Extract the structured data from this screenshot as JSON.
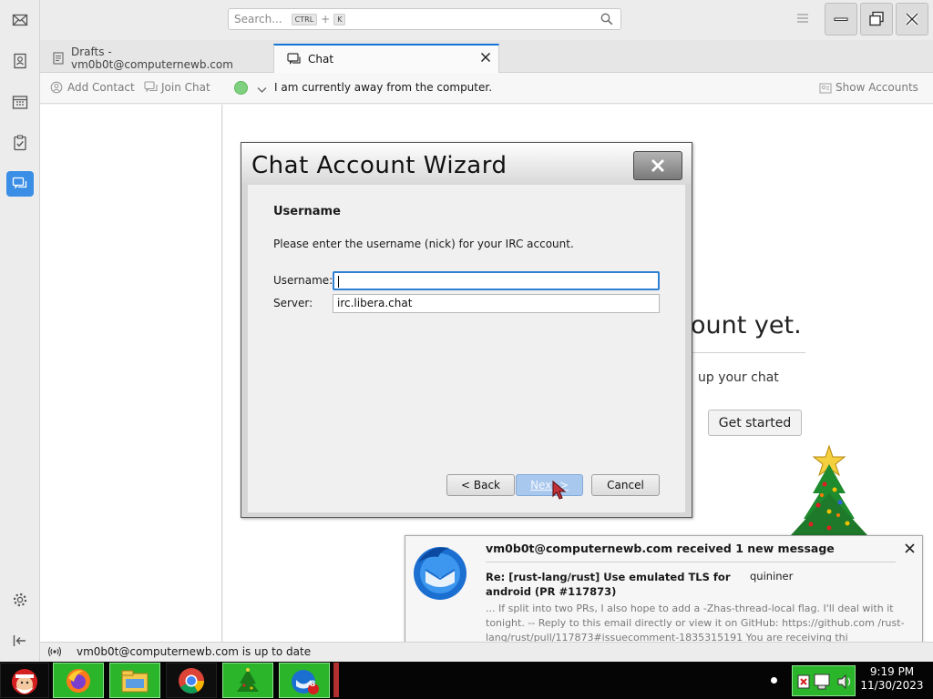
{
  "titlebar": {
    "search_placeholder": "Search...",
    "shortcut_mod": "CTRL",
    "shortcut_plus": "+",
    "shortcut_key": "K"
  },
  "tabs": [
    {
      "label": "Drafts - vm0b0t@computernewb.com"
    },
    {
      "label": "Chat"
    }
  ],
  "chat_toolbar": {
    "add_contact": "Add Contact",
    "join_chat": "Join Chat",
    "status_message": "I am currently away from the computer.",
    "show_accounts": "Show Accounts"
  },
  "background": {
    "heading_fragment": "ount yet.",
    "sub_fragment": "up your chat",
    "get_started": "Get started"
  },
  "dialog": {
    "title": "Chat Account Wizard",
    "heading": "Username",
    "description": "Please enter the username (nick) for your IRC account.",
    "username_label": "Username:",
    "username_value": "",
    "server_label": "Server:",
    "server_value": "irc.libera.chat",
    "back": "< Back",
    "next": "Next >",
    "cancel": "Cancel"
  },
  "notification": {
    "title": "vm0b0t@computernewb.com received 1 new message",
    "subject": "Re: [rust-lang/rust] Use emulated TLS for android (PR #117873)",
    "sender": "quininer",
    "body": "... If split into two PRs, I also hope to add a -Zhas-thread-local flag. I'll deal with it tonight. -- Reply to this email directly or view it on GitHub: https://github.com /rust-lang/rust/pull/117873#issuecomment-1835315191 You are receiving thi"
  },
  "statusbar": {
    "text": "vm0b0t@computernewb.com is up to date"
  },
  "taskbar": {
    "time": "9:19 PM",
    "date": "11/30/2023",
    "thunderbird_badge": "8"
  },
  "colors": {
    "accent": "#1373d9",
    "status_available": "#7fd17f",
    "taskbar_green": "#2bb52b"
  }
}
